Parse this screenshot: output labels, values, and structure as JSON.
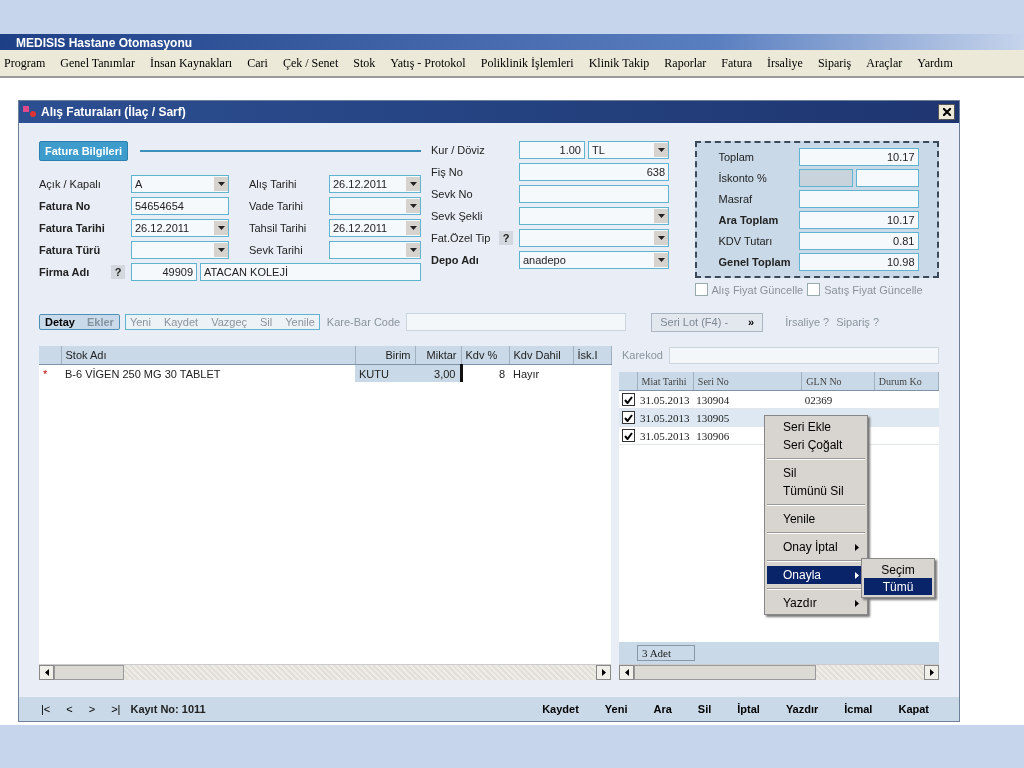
{
  "app": {
    "title": "MEDISIS Hastane Otomasyonu"
  },
  "menu": [
    "Program",
    "Genel Tanımlar",
    "İnsan Kaynakları",
    "Cari",
    "Çek / Senet",
    "Stok",
    "Yatış - Protokol",
    "Poliklinik İşlemleri",
    "Klinik Takip",
    "Raporlar",
    "Fatura",
    "İrsaliye",
    "Sipariş",
    "Araçlar",
    "Yardım"
  ],
  "window": {
    "title": "Alış Faturaları (İlaç / Sarf)"
  },
  "invoice": {
    "section": "Fatura Bilgileri",
    "col1": [
      {
        "label": "Açık / Kapalı",
        "bold": false,
        "inputs": [
          {
            "kind": "dropdown",
            "value": "A"
          }
        ]
      },
      {
        "label": "Fatura No",
        "bold": true,
        "inputs": [
          {
            "kind": "text",
            "value": "54654654"
          }
        ]
      },
      {
        "label": "Fatura Tarihi",
        "bold": true,
        "inputs": [
          {
            "kind": "dropdown",
            "value": "26.12.2011"
          }
        ]
      },
      {
        "label": "Fatura Türü",
        "bold": true,
        "inputs": [
          {
            "kind": "dropdown"
          }
        ]
      }
    ],
    "col2": [
      {
        "label": "Alış Tarihi",
        "bold": false,
        "inputs": [
          {
            "kind": "dropdown",
            "value": "26.12.2011"
          }
        ]
      },
      {
        "label": "Vade Tarihi",
        "bold": false,
        "inputs": [
          {
            "kind": "dropdown"
          }
        ]
      },
      {
        "label": "Tahsil Tarihi",
        "bold": false,
        "inputs": [
          {
            "kind": "dropdown",
            "value": "26.12.2011"
          }
        ]
      },
      {
        "label": "Sevk Tarihi",
        "bold": false,
        "inputs": [
          {
            "kind": "dropdown"
          }
        ]
      }
    ],
    "firm": {
      "label": "Firma Adı",
      "bold": true,
      "help": "?",
      "inputs": [
        {
          "kind": "number",
          "value": "49909"
        },
        {
          "kind": "text",
          "value": "ATACAN KOLEJİ"
        }
      ]
    },
    "col3": [
      {
        "label": "Kur / Döviz",
        "bold": false,
        "inputs": [
          {
            "kind": "number",
            "value": "1.00"
          },
          {
            "kind": "dropdown",
            "value": "TL"
          }
        ]
      },
      {
        "label": "Fiş No",
        "bold": false,
        "inputs": [
          {
            "kind": "number",
            "value": "638"
          }
        ]
      },
      {
        "label": "Sevk No",
        "bold": false,
        "inputs": [
          {
            "kind": "text"
          }
        ]
      },
      {
        "label": "Sevk Şekli",
        "bold": false,
        "inputs": [
          {
            "kind": "dropdown"
          }
        ]
      },
      {
        "label": "Fat.Özel Tip",
        "bold": false,
        "help": "?",
        "inputs": [
          {
            "kind": "dropdown"
          }
        ]
      },
      {
        "label": "Depo Adı",
        "bold": true,
        "inputs": [
          {
            "kind": "dropdown",
            "value": "anadepo"
          }
        ]
      }
    ],
    "totals": [
      {
        "label": "Toplam",
        "bold": false,
        "inputs": [
          {
            "kind": "number",
            "value": "10.17"
          }
        ]
      },
      {
        "label": "İskonto %",
        "bold": false,
        "inputs": [
          {
            "kind": "number",
            "disabled": true
          },
          {
            "kind": "number"
          }
        ]
      },
      {
        "label": "Masraf",
        "bold": false,
        "inputs": [
          {
            "kind": "number"
          }
        ]
      },
      {
        "label": "Ara Toplam",
        "bold": true,
        "inputs": [
          {
            "kind": "number",
            "value": "10.17"
          }
        ]
      },
      {
        "label": "KDV Tutarı",
        "bold": false,
        "inputs": [
          {
            "kind": "number",
            "value": "0.81"
          }
        ]
      },
      {
        "label": "Genel Toplam",
        "bold": true,
        "inputs": [
          {
            "kind": "number",
            "value": "10.98"
          }
        ]
      }
    ],
    "options": [
      {
        "label": "Alış Fiyat Güncelle",
        "checked": false
      },
      {
        "label": "Satış Fiyat Güncelle",
        "checked": false
      }
    ]
  },
  "detail_tabs": [
    {
      "label": "Detay",
      "selected": true
    },
    {
      "label": "Ekler",
      "selected": false
    }
  ],
  "detail_actions": [
    "Yeni",
    "Kaydet",
    "Vazgeç",
    "Sil",
    "Yenile"
  ],
  "barcode": {
    "label": "Kare-Bar Code"
  },
  "serial_button": {
    "label": "Seri Lot (F4) -",
    "arrow": "»"
  },
  "links": [
    "İrsaliye ?",
    "Sipariş ?"
  ],
  "items_table": {
    "columns": [
      "",
      "Stok Adı",
      "Birim",
      "Miktar",
      "Kdv %",
      "Kdv Dahil",
      "İsk.I"
    ],
    "rows": [
      {
        "cells": [
          "*",
          "B-6 VİGEN 250 MG 30 TABLET",
          "KUTU",
          "3,00",
          "8",
          "Hayır",
          ""
        ]
      }
    ]
  },
  "serials": {
    "label": "Karekod",
    "columns": [
      "Miat Tarihi",
      "Seri No",
      "GLN No",
      "Durum Ko"
    ],
    "rows": [
      {
        "checked": true,
        "selected": false,
        "cells": [
          "31.05.2013",
          "130904",
          "02369",
          ""
        ]
      },
      {
        "checked": true,
        "selected": true,
        "cells": [
          "31.05.2013",
          "130905",
          "",
          ""
        ]
      },
      {
        "checked": true,
        "selected": false,
        "cells": [
          "31.05.2013",
          "130906",
          "",
          ""
        ]
      }
    ],
    "count": "3 Adet"
  },
  "context_menu": {
    "groups": [
      [
        {
          "label": "Seri Ekle",
          "submenu": false,
          "selected": false
        },
        {
          "label": "Seri Çoğalt",
          "submenu": false,
          "selected": false
        }
      ],
      [
        {
          "label": "Sil",
          "submenu": false,
          "selected": false
        },
        {
          "label": "Tümünü Sil",
          "submenu": false,
          "selected": false
        }
      ],
      [
        {
          "label": "Yenile",
          "submenu": false,
          "selected": false
        }
      ],
      [
        {
          "label": "Onay İptal",
          "submenu": true,
          "selected": false
        }
      ],
      [
        {
          "label": "Onayla",
          "submenu": true,
          "selected": true
        }
      ],
      [
        {
          "label": "Yazdır",
          "submenu": true,
          "selected": false
        }
      ]
    ],
    "submenu": [
      {
        "label": "Seçim",
        "selected": false
      },
      {
        "label": "Tümü",
        "selected": true
      }
    ]
  },
  "navigator": [
    "|<",
    "<",
    ">",
    ">|"
  ],
  "record": "Kayıt No: 1011",
  "footer_buttons": [
    "Kaydet",
    "Yeni",
    "Ara",
    "Sil",
    "İptal",
    "Yazdır",
    "İcmal",
    "Kapat"
  ]
}
